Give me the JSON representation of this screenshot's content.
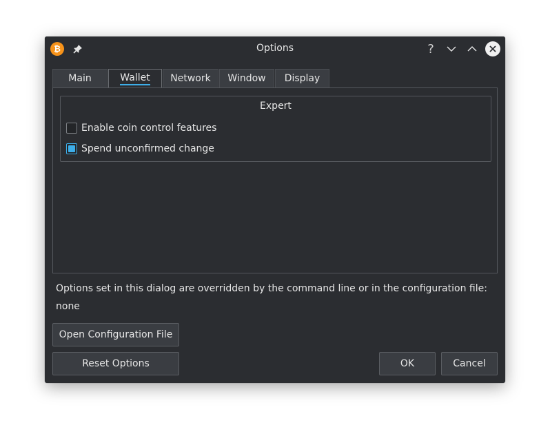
{
  "window": {
    "title": "Options",
    "app_icon_glyph": "₿",
    "help_glyph": "?"
  },
  "tabs": [
    {
      "label": "Main"
    },
    {
      "label": "Wallet",
      "active": true
    },
    {
      "label": "Network"
    },
    {
      "label": "Window"
    },
    {
      "label": "Display"
    }
  ],
  "expert_group": {
    "title": "Expert",
    "options": [
      {
        "label": "Enable coin control features",
        "checked": false
      },
      {
        "label": "Spend unconfirmed change",
        "checked": true
      }
    ]
  },
  "info": {
    "override_text": "Options set in this dialog are overridden by the command line or in the configuration file:",
    "override_value": "none"
  },
  "buttons": {
    "open_config": "Open Configuration File",
    "reset": "Reset Options",
    "ok": "OK",
    "cancel": "Cancel"
  },
  "colors": {
    "accent": "#3daee9",
    "app_icon": "#f7931a",
    "background": "#2b2d31"
  }
}
